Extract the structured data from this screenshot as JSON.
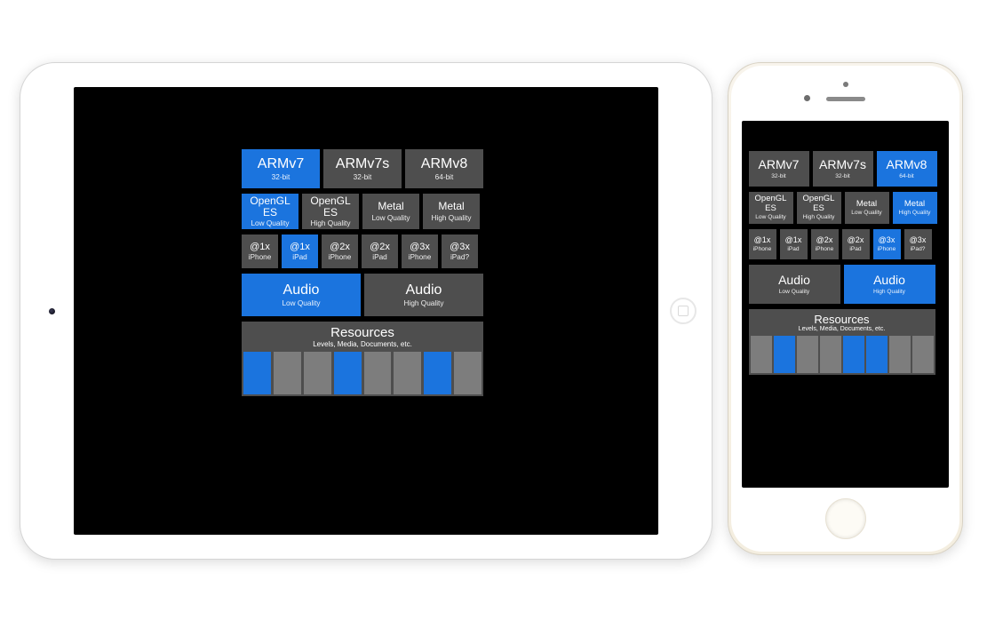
{
  "colors": {
    "selected": "#1b74de",
    "tile": "#4e4e4e",
    "bar": "#7d7d7d"
  },
  "arch": [
    {
      "title": "ARMv7",
      "sub": "32-bit"
    },
    {
      "title": "ARMv7s",
      "sub": "32-bit"
    },
    {
      "title": "ARMv8",
      "sub": "64-bit"
    }
  ],
  "gfx": [
    {
      "title": "OpenGL ES",
      "sub": "Low Quality"
    },
    {
      "title": "OpenGL ES",
      "sub": "High Quality"
    },
    {
      "title": "Metal",
      "sub": "Low Quality"
    },
    {
      "title": "Metal",
      "sub": "High Quality"
    }
  ],
  "scale": [
    {
      "title": "@1x",
      "sub": "iPhone"
    },
    {
      "title": "@1x",
      "sub": "iPad"
    },
    {
      "title": "@2x",
      "sub": "iPhone"
    },
    {
      "title": "@2x",
      "sub": "iPad"
    },
    {
      "title": "@3x",
      "sub": "iPhone"
    },
    {
      "title": "@3x",
      "sub": "iPad?"
    }
  ],
  "audio": [
    {
      "title": "Audio",
      "sub": "Low Quality"
    },
    {
      "title": "Audio",
      "sub": "High Quality"
    }
  ],
  "resources": {
    "title": "Resources",
    "sub": "Levels, Media, Documents, etc."
  },
  "ipad": {
    "arch_selected": [
      true,
      false,
      false
    ],
    "gfx_selected": [
      true,
      false,
      false,
      false
    ],
    "scale_selected": [
      false,
      true,
      false,
      false,
      false,
      false
    ],
    "audio_selected": [
      true,
      false
    ],
    "resource_bars": [
      true,
      false,
      false,
      true,
      false,
      false,
      true,
      false
    ]
  },
  "iphone": {
    "arch_selected": [
      false,
      false,
      true
    ],
    "gfx_selected": [
      false,
      false,
      false,
      true
    ],
    "scale_selected": [
      false,
      false,
      false,
      false,
      true,
      false
    ],
    "audio_selected": [
      false,
      true
    ],
    "resource_bars": [
      false,
      true,
      false,
      false,
      true,
      true,
      false,
      false
    ]
  }
}
